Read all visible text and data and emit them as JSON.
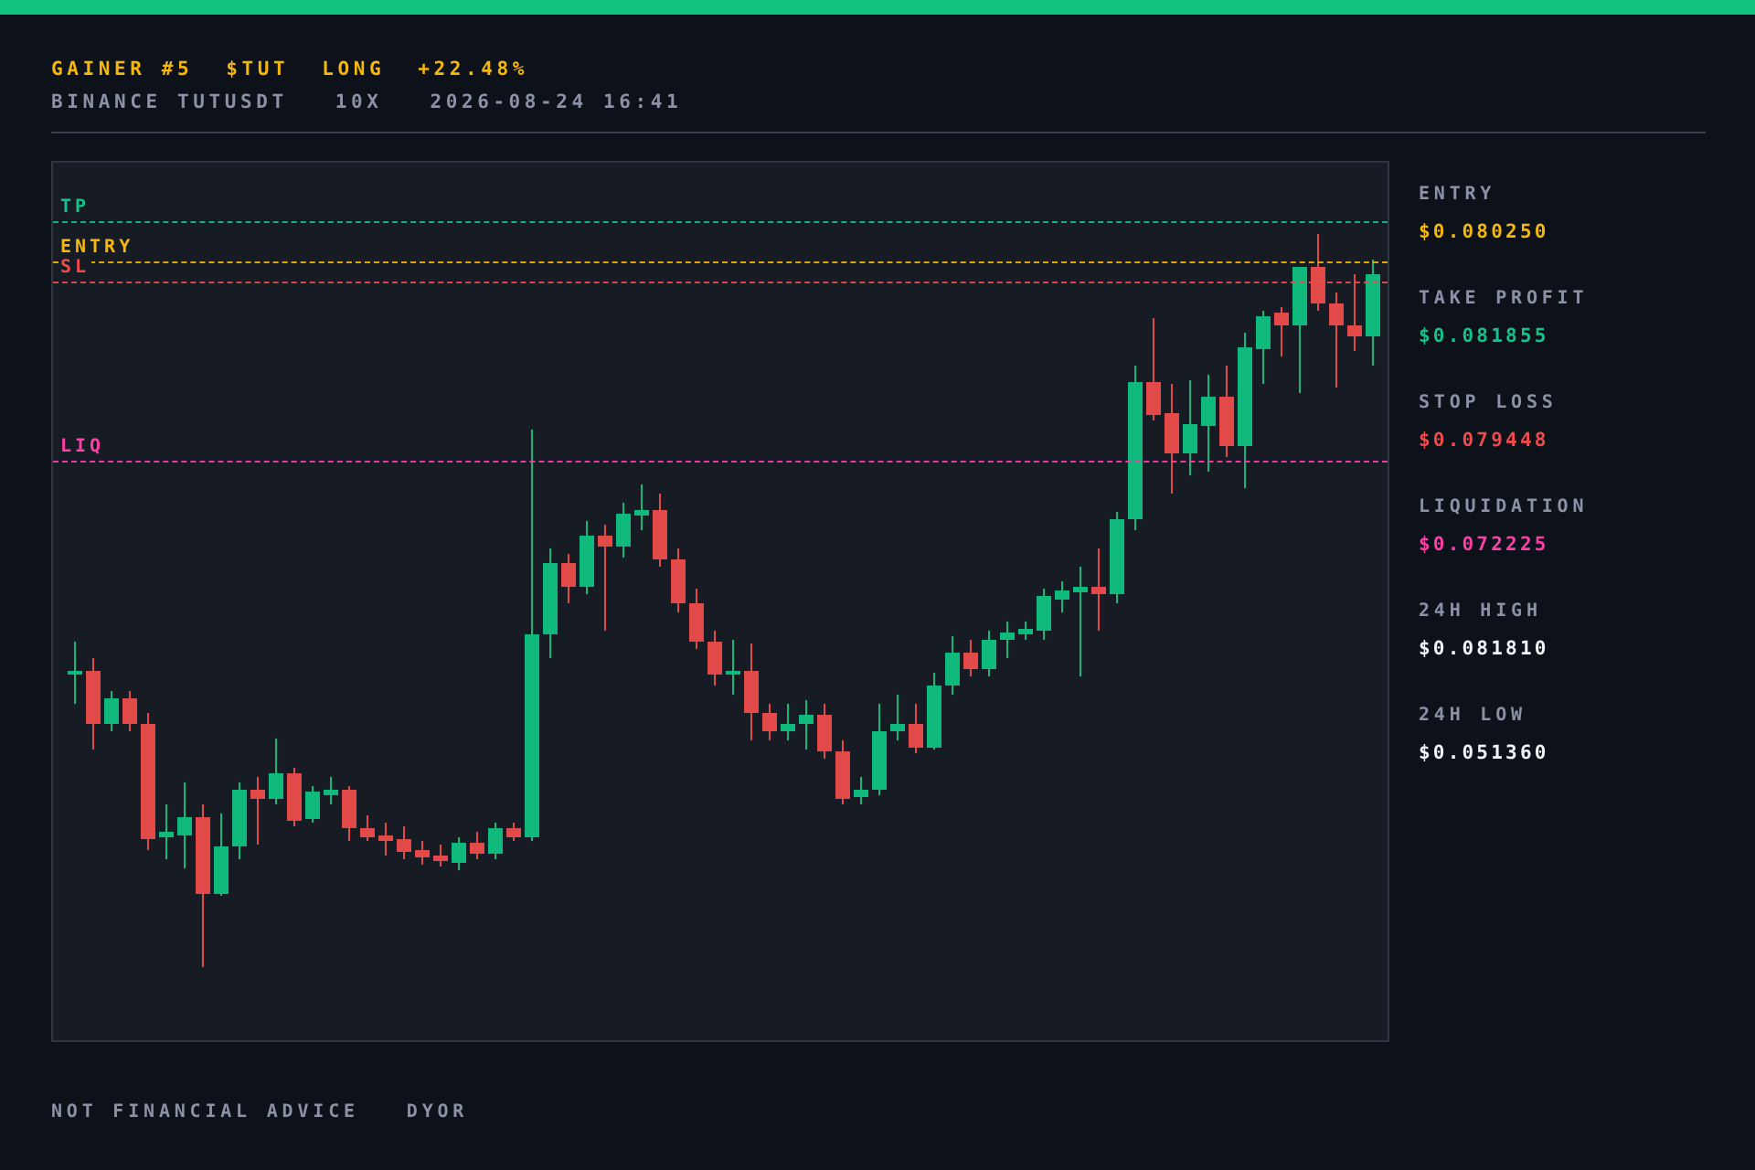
{
  "header": {
    "title": [
      {
        "text": "GAINER #5"
      },
      {
        "text": "$TUT"
      },
      {
        "text": "LONG"
      },
      {
        "text": "+22.48%"
      }
    ],
    "subtitle": [
      {
        "text": "BINANCE TUTUSDT"
      },
      {
        "text": "10X"
      },
      {
        "text": "2026-08-24 16:41"
      }
    ]
  },
  "chart": {
    "levels": [
      {
        "label": "TP",
        "kind": "tp"
      },
      {
        "label": "ENTRY",
        "kind": "entry"
      },
      {
        "label": "SL",
        "kind": "sl"
      },
      {
        "label": "LIQ",
        "kind": "liq"
      }
    ]
  },
  "stats": [
    {
      "label": "ENTRY",
      "value": "$0.080250",
      "kind": "entry"
    },
    {
      "label": "TAKE PROFIT",
      "value": "$0.081855",
      "kind": "tp"
    },
    {
      "label": "STOP LOSS",
      "value": "$0.079448",
      "kind": "sl"
    },
    {
      "label": "LIQUIDATION",
      "value": "$0.072225",
      "kind": "liq"
    },
    {
      "label": "24H HIGH",
      "value": "$0.081810",
      "kind": "plain"
    },
    {
      "label": "24H LOW",
      "value": "$0.051360",
      "kind": "plain"
    }
  ],
  "footer": [
    {
      "text": "NOT FINANCIAL ADVICE"
    },
    {
      "text": "DYOR"
    }
  ]
}
